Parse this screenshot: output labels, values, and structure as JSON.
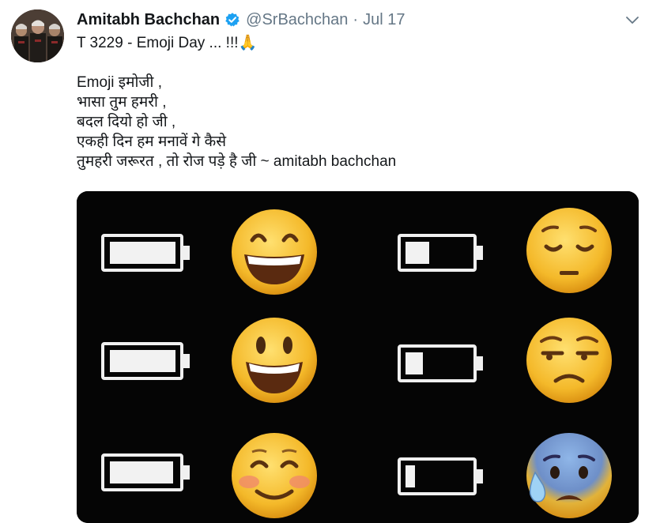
{
  "tweet": {
    "author_name": "Amitabh Bachchan",
    "handle": "@SrBachchan",
    "separator": "·",
    "date": "Jul 17",
    "title_line": "T 3229 - Emoji Day ... !!!",
    "title_emoji": "🙏",
    "poem_lines": [
      "Emoji इमोजी ,",
      "भासा तुम हमरी ,",
      "बदल दियो हो जी ,",
      "एकही दिन हम मनावें गे कैसे",
      "तुमहरी जरूरत , तो रोज पड़े है जी  ~ amitabh bachchan"
    ]
  },
  "icons": {
    "verified": "verified-badge-icon",
    "caret": "chevron-down-icon"
  },
  "media": {
    "rows_left": [
      {
        "battery_level": 1.0,
        "emoji": "grinning-smiling-eyes"
      },
      {
        "battery_level": 1.0,
        "emoji": "smiley-open-mouth"
      },
      {
        "battery_level": 0.95,
        "emoji": "blushing-smile"
      }
    ],
    "rows_right": [
      {
        "battery_level": 0.3,
        "emoji": "pensive-face"
      },
      {
        "battery_level": 0.22,
        "emoji": "unamused-face"
      },
      {
        "battery_level": 0.12,
        "emoji": "anxious-face-with-sweat"
      }
    ]
  },
  "colors": {
    "verified_blue": "#1da1f2",
    "handle_gray": "#657786",
    "emoji_yellow": "#f5c030",
    "battery_white": "#f2f2f2"
  }
}
